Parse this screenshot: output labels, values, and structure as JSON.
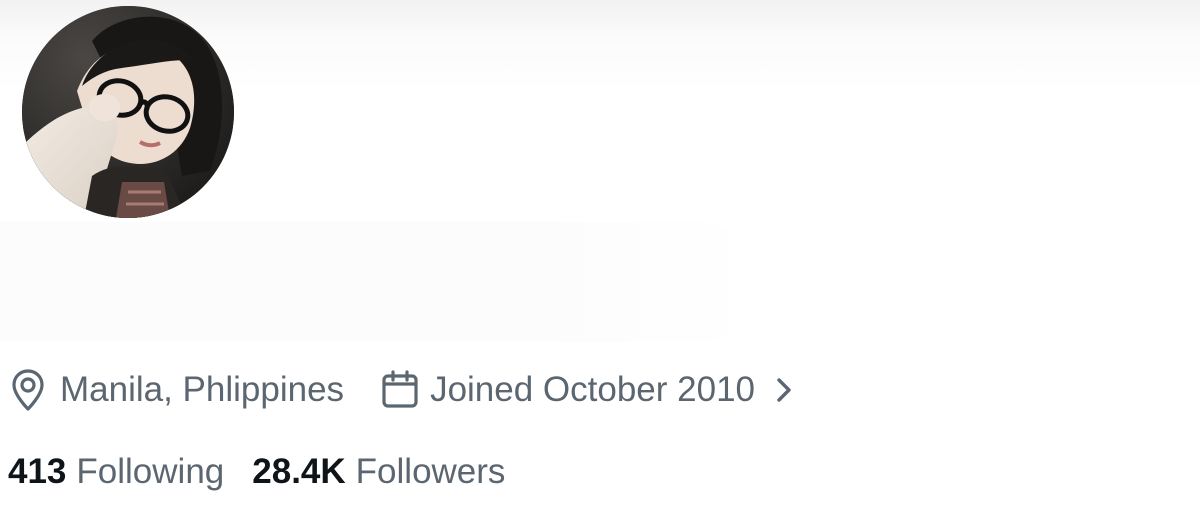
{
  "profile": {
    "avatar_icon": "profile-photo",
    "location": {
      "icon": "location-pin-icon",
      "text": "Manila, Phlippines"
    },
    "joined": {
      "icon": "calendar-icon",
      "text": "Joined October 2010",
      "chevron_icon": "chevron-right-icon"
    },
    "stats": {
      "following_count": "413",
      "following_label": "Following",
      "followers_count": "28.4K",
      "followers_label": "Followers"
    }
  },
  "colors": {
    "primary_text": "#0f1419",
    "secondary_text": "#5b6670",
    "background": "#ffffff",
    "top_fade": "#f2f2f2"
  }
}
